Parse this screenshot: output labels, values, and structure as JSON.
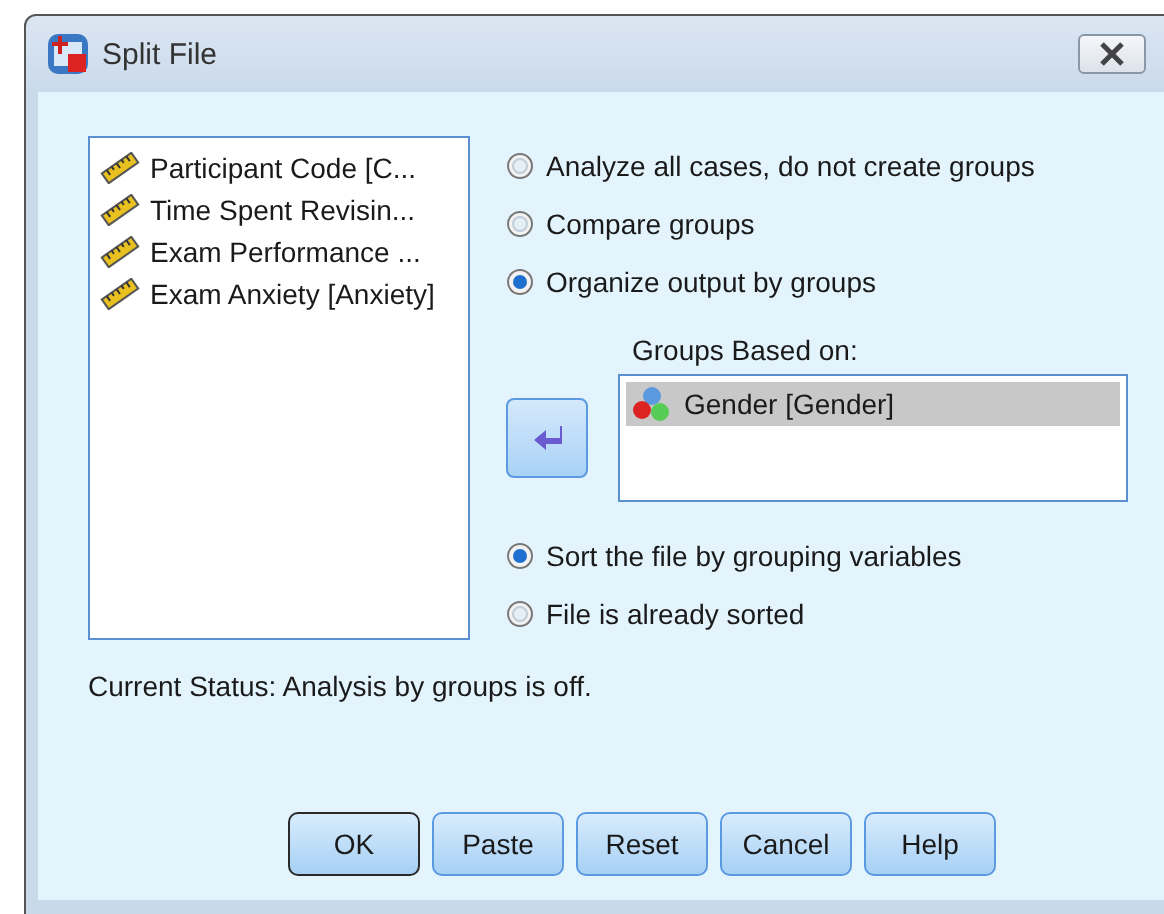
{
  "window": {
    "title": "Split File"
  },
  "variables": [
    {
      "label": "Participant Code [C..."
    },
    {
      "label": "Time Spent Revisin..."
    },
    {
      "label": "Exam Performance ..."
    },
    {
      "label": "Exam Anxiety [Anxiety]"
    }
  ],
  "mode_options": [
    {
      "label": "Analyze all cases, do not create groups",
      "selected": false
    },
    {
      "label": "Compare groups",
      "selected": false
    },
    {
      "label": "Organize output by groups",
      "selected": true
    }
  ],
  "groups": {
    "label": "Groups Based on:",
    "items": [
      {
        "label": "Gender [Gender]",
        "selected": true
      }
    ]
  },
  "sort_options": [
    {
      "label": "Sort the file by grouping variables",
      "selected": true
    },
    {
      "label": "File is already sorted",
      "selected": false
    }
  ],
  "status": "Current Status: Analysis by groups is off.",
  "buttons": [
    {
      "label": "OK",
      "default": true
    },
    {
      "label": "Paste",
      "default": false
    },
    {
      "label": "Reset",
      "default": false
    },
    {
      "label": "Cancel",
      "default": false
    },
    {
      "label": "Help",
      "default": false
    }
  ]
}
